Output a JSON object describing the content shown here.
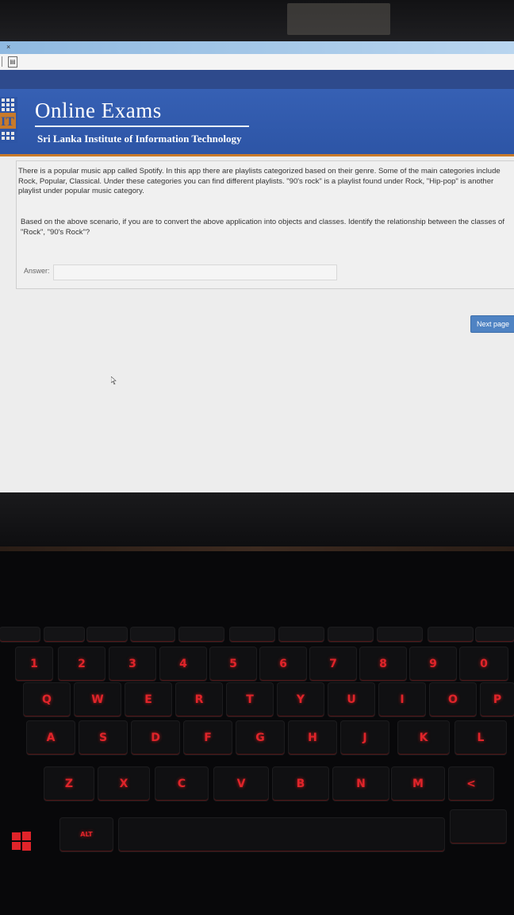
{
  "browser": {
    "tab_close": "×",
    "page_icon": "document-icon"
  },
  "banner": {
    "title": "Online Exams",
    "subtitle": "Sri Lanka Institute of Information Technology",
    "logo_text": "IT"
  },
  "question": {
    "paragraph1": "There is a popular music app called Spotify. In this app there are playlists categorized based on their genre. Some of the main categories include Rock, Popular, Classical. Under these categories you can find different playlists. \"90's rock\" is a playlist found under Rock, \"Hip-pop\" is another playlist under popular music category.",
    "paragraph2": "Based on the above scenario, if you are to convert the above application into objects and classes. Identify the relationship between the classes of \"Rock\", \"90's Rock\"?",
    "answer_label": "Answer:",
    "answer_value": ""
  },
  "navigation": {
    "next_label": "Next page"
  },
  "keyboard": {
    "row_numbers": [
      "1",
      "2",
      "3",
      "4",
      "5",
      "6",
      "7",
      "8",
      "9",
      "0"
    ],
    "row_top": [
      "Q",
      "W",
      "E",
      "R",
      "T",
      "Y",
      "U",
      "I",
      "O",
      "P"
    ],
    "row_home": [
      "A",
      "S",
      "D",
      "F",
      "G",
      "H",
      "J",
      "K",
      "L"
    ],
    "row_bottom": [
      "Z",
      "X",
      "C",
      "V",
      "B",
      "N",
      "M"
    ],
    "alt_label": "ALT",
    "backlight_color": "#e0242a"
  },
  "colors": {
    "banner_blue": "#3660b4",
    "nav_blue": "#2e4a8c",
    "accent_orange": "#c87a2a",
    "button_blue": "#4f83c3"
  }
}
